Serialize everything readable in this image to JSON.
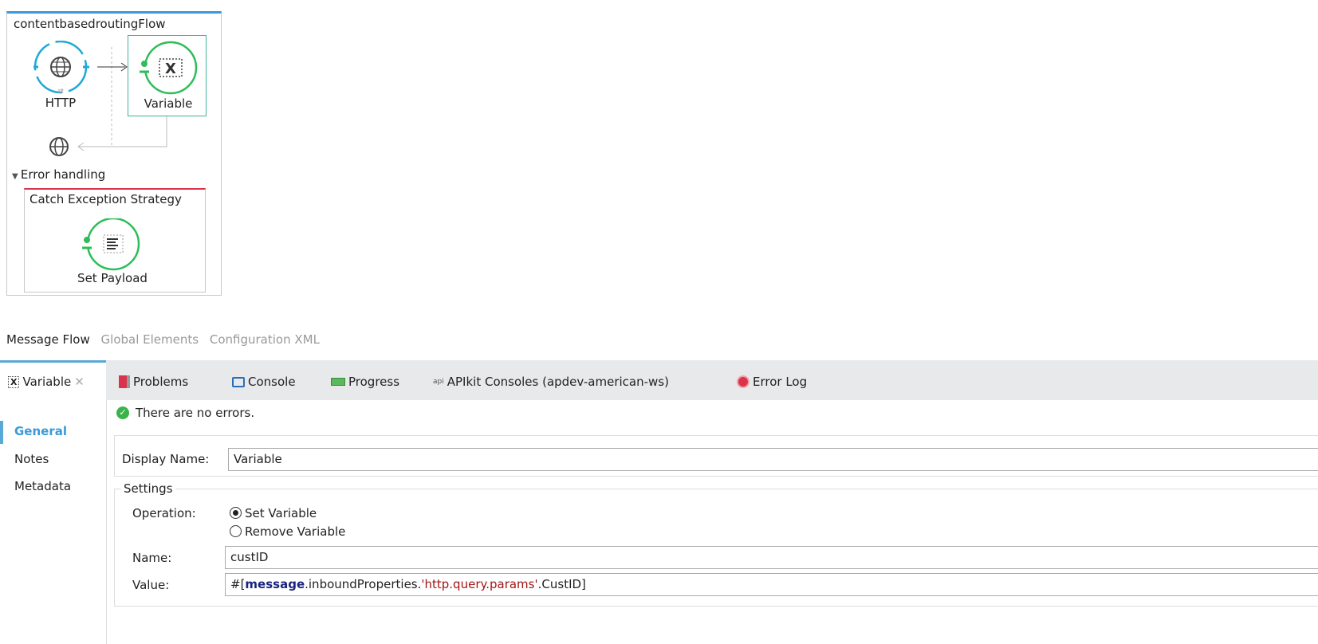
{
  "flow": {
    "title": "contentbasedroutingFlow",
    "http_label": "HTTP",
    "variable_label": "Variable",
    "error_handling": "Error handling",
    "catch_title": "Catch Exception Strategy",
    "set_payload_label": "Set Payload"
  },
  "editor_tabs": [
    {
      "label": "Message Flow",
      "active": true
    },
    {
      "label": "Global Elements"
    },
    {
      "label": "Configuration XML"
    }
  ],
  "panel_tabs": [
    {
      "label": "Variable",
      "icon": "variable-icon"
    },
    {
      "label": "Problems",
      "icon": "problems-icon"
    },
    {
      "label": "Console",
      "icon": "console-icon"
    },
    {
      "label": "Progress",
      "icon": "progress-icon"
    },
    {
      "label": "APIkit Consoles (apdev-american-ws)",
      "icon": "api-icon",
      "icon_text": "api"
    },
    {
      "label": "Error Log",
      "icon": "error-log-icon"
    }
  ],
  "nav": [
    "General",
    "Notes",
    "Metadata"
  ],
  "status": "There are no errors.",
  "form": {
    "display_name_label": "Display Name:",
    "display_name": "Variable",
    "settings_legend": "Settings",
    "operation_label": "Operation:",
    "op_set": "Set Variable",
    "op_remove": "Remove Variable",
    "name_label": "Name:",
    "name_value": "custID",
    "value_label": "Value:",
    "value_parts": {
      "open": "#[",
      "kw": "message",
      "mid": ".inboundProperties.",
      "str": "'http.query.params'",
      "tail": ".CustID]"
    }
  },
  "colors": {
    "accent": "#5aa8d8",
    "flow_green": "#2ebd59",
    "http_blue": "#1fa9d6",
    "error_red": "#d9344b"
  }
}
